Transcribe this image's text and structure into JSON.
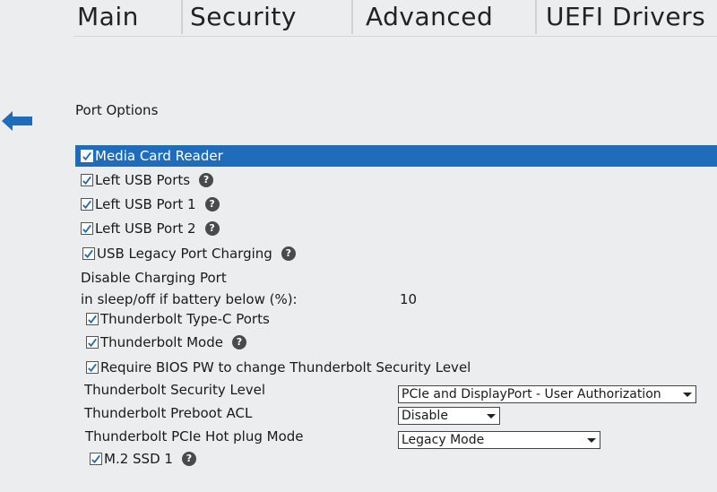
{
  "tabs": [
    "Main",
    "Security",
    "Advanced",
    "UEFI Drivers"
  ],
  "section_title": "Port Options",
  "options": {
    "media_card_reader": "Media Card Reader",
    "left_usb_ports": "Left USB Ports",
    "left_usb_port_1": "Left USB Port 1",
    "left_usb_port_2": "Left USB Port 2",
    "usb_legacy_port_charging": "USB Legacy Port Charging",
    "disable_charging_line1": "Disable Charging Port",
    "disable_charging_line2": "in sleep/off if battery below (%):",
    "disable_charging_value": "10",
    "thunderbolt_typec_ports": "Thunderbolt Type-C Ports",
    "thunderbolt_mode": "Thunderbolt Mode",
    "require_bios_pw": "Require BIOS PW to change Thunderbolt Security Level",
    "tb_security_level_label": "Thunderbolt Security Level",
    "tb_security_level_value": "PCIe and DisplayPort - User Authorization",
    "tb_preboot_acl_label": "Thunderbolt Preboot ACL",
    "tb_preboot_acl_value": "Disable",
    "tb_hotplug_label": "Thunderbolt PCIe Hot plug Mode",
    "tb_hotplug_value": "Legacy Mode",
    "m2_ssd_1": "M.2 SSD 1"
  },
  "help_glyph": "?",
  "colors": {
    "highlight": "#1f6dba",
    "background": "#ecedee"
  }
}
